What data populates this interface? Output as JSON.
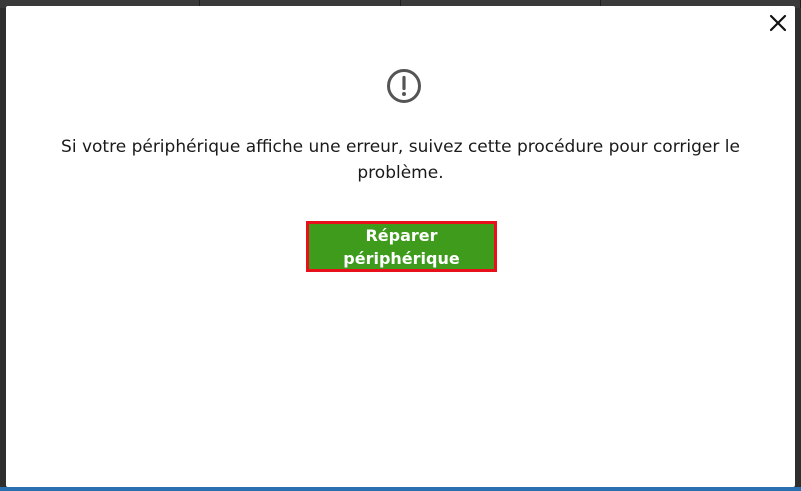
{
  "dialog": {
    "message": "Si votre périphérique affiche une erreur, suivez cette procédure pour corriger le problème.",
    "primary_button_label": "Réparer périphérique",
    "close_icon": "close-icon",
    "status_icon": "exclamation-circle-icon"
  },
  "colors": {
    "button_background": "#3e9b1c",
    "button_highlight_border": "#e8101a",
    "icon_color": "#555555",
    "text_color": "#1a1a1a"
  }
}
